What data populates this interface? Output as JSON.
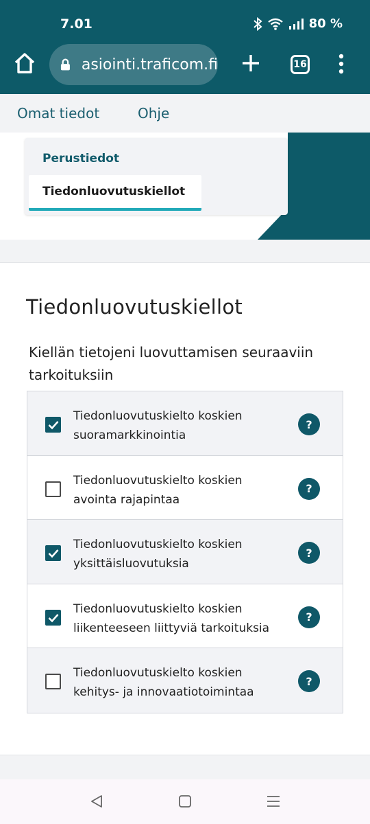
{
  "status_bar": {
    "time": "7.01",
    "battery": "80 %"
  },
  "browser": {
    "url": "asiointi.traficom.fi",
    "tab_count": "16"
  },
  "top_nav": {
    "items": [
      "Omat tiedot",
      "Ohje"
    ]
  },
  "sub_nav": {
    "items": [
      "Perustiedot",
      "Tiedonluovutuskiellot"
    ],
    "active": "Tiedonluovutuskiellot"
  },
  "main": {
    "title": "Tiedonluovutuskiellot",
    "intro": "Kiellän tietojeni luovuttamisen seuraaviin tarkoituksiin",
    "options": [
      {
        "line1": "Tiedonluovutuskielto koskien",
        "line2": "suoramarkkinointia",
        "checked": true,
        "help": "?"
      },
      {
        "line1": "Tiedonluovutuskielto koskien",
        "line2": "avointa rajapintaa",
        "checked": false,
        "help": "?"
      },
      {
        "line1": "Tiedonluovutuskielto koskien",
        "line2": "yksittäisluovutuksia",
        "checked": true,
        "help": "?"
      },
      {
        "line1": "Tiedonluovutuskielto koskien",
        "line2": "liikenteeseen liittyviä tarkoituksia",
        "checked": true,
        "help": "?"
      },
      {
        "line1": "Tiedonluovutuskielto koskien",
        "line2": "kehitys- ja innovaatiotoimintaa",
        "checked": false,
        "help": "?"
      }
    ]
  },
  "colors": {
    "brand": "#0d5a68",
    "accent": "#21a9b8"
  }
}
